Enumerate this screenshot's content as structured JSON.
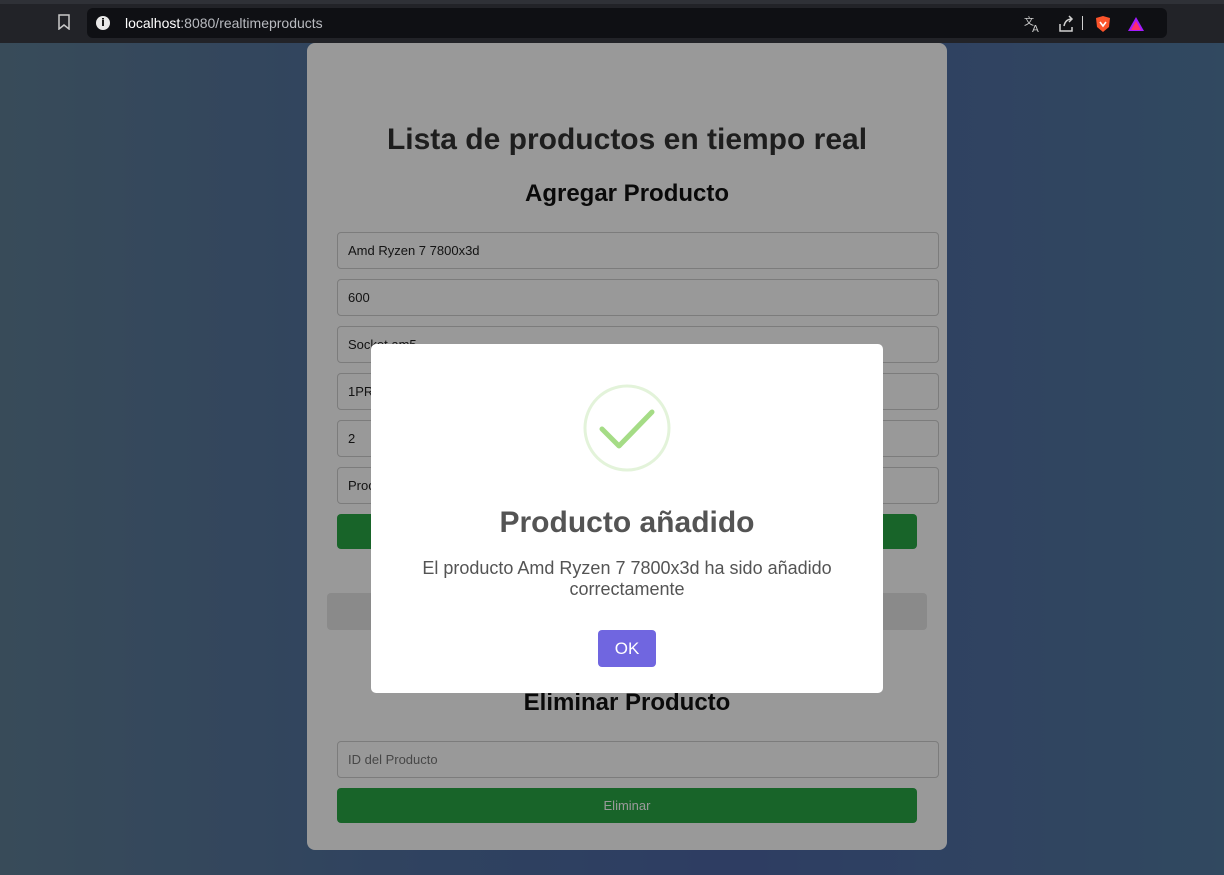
{
  "browser": {
    "url_host": "localhost",
    "url_rest": ":8080/realtimeproducts",
    "info_glyph": "i",
    "icons": [
      "bookmark-icon",
      "info-icon",
      "translate-icon",
      "share-icon",
      "brave-shield-icon",
      "brave-rewards-icon"
    ]
  },
  "page": {
    "title": "Lista de productos en tiempo real",
    "add_section_title": "Agregar Producto",
    "add_fields": [
      {
        "value": "Amd Ryzen 7 7800x3d"
      },
      {
        "value": "600"
      },
      {
        "value": "Socket am5"
      },
      {
        "value": "1PR"
      },
      {
        "value": "2"
      },
      {
        "value": "Proc"
      }
    ],
    "add_button_label": "",
    "delete_section_title": "Eliminar Producto",
    "delete_id_placeholder": "ID del Producto",
    "delete_button_label": "Eliminar"
  },
  "modal": {
    "icon": "success-check-icon",
    "title": "Producto añadido",
    "text": "El producto Amd Ryzen 7 7800x3d ha sido añadido correctamente",
    "ok_label": "OK"
  },
  "colors": {
    "green_button": "#28a745",
    "ok_button": "#7066e0",
    "check": "#a5dc86"
  }
}
